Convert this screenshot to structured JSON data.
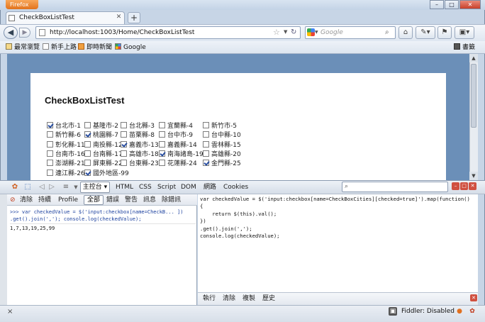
{
  "browser": {
    "app_button": "Firefox",
    "tab_title": "CheckBoxListTest",
    "new_tab": "+",
    "url": "http://localhost:1003/Home/CheckBoxListTest",
    "search_placeholder": "Google",
    "window_controls": {
      "min": "–",
      "max": "□",
      "close": "✕"
    }
  },
  "bookmarks": {
    "items": [
      {
        "label": "最常瀏覽",
        "icon": "bookmark-folder-icon"
      },
      {
        "label": "新手上路",
        "icon": "page-icon"
      },
      {
        "label": "即時新聞",
        "icon": "rss-icon"
      },
      {
        "label": "Google",
        "icon": "google-icon"
      }
    ],
    "right": "書籤"
  },
  "page": {
    "heading": "CheckBoxListTest",
    "checkbox_rows": [
      [
        {
          "label": "台北市-1",
          "checked": true
        },
        {
          "label": "基隆市-2",
          "checked": false
        },
        {
          "label": "台北縣-3",
          "checked": false
        },
        {
          "label": "宜蘭縣-4",
          "checked": false
        },
        {
          "label": "新竹市-5",
          "checked": false
        }
      ],
      [
        {
          "label": "新竹縣-6",
          "checked": false
        },
        {
          "label": "桃園縣-7",
          "checked": true
        },
        {
          "label": "苗栗縣-8",
          "checked": false
        },
        {
          "label": "台中市-9",
          "checked": false
        },
        {
          "label": "台中縣-10",
          "checked": false
        }
      ],
      [
        {
          "label": "彰化縣-11",
          "checked": false
        },
        {
          "label": "南投縣-12",
          "checked": false
        },
        {
          "label": "嘉義市-13",
          "checked": true
        },
        {
          "label": "嘉義縣-14",
          "checked": false
        },
        {
          "label": "雲林縣-15",
          "checked": false
        }
      ],
      [
        {
          "label": "台南市-16",
          "checked": false
        },
        {
          "label": "台南縣-17",
          "checked": false
        },
        {
          "label": "高雄市-18",
          "checked": false
        },
        {
          "label": "南海諸島-19",
          "checked": true
        },
        {
          "label": "高雄縣-20",
          "checked": false
        }
      ],
      [
        {
          "label": "澎湖縣-21",
          "checked": false
        },
        {
          "label": "屏東縣-22",
          "checked": false
        },
        {
          "label": "台東縣-23",
          "checked": false
        },
        {
          "label": "花蓮縣-24",
          "checked": false
        },
        {
          "label": "金門縣-25",
          "checked": true
        }
      ],
      [
        {
          "label": "連江縣-26",
          "checked": false
        },
        {
          "label": "國外地區-99",
          "checked": true
        }
      ]
    ]
  },
  "firebug": {
    "console_tab": "主控台",
    "tabs": [
      "HTML",
      "CSS",
      "Script",
      "DOM",
      "網路",
      "Cookies"
    ],
    "toolbar": {
      "clear": "清除",
      "persist": "持續",
      "profile": "Profile",
      "all": "全部",
      "errors": "錯誤",
      "warnings": "警告",
      "info": "訊息",
      "debug": "除錯訊"
    },
    "log_command_1": ">>> var checkedValue = $('input:checkbox[name=CheckB... ])",
    "log_command_2": ".get().join(','); console.log(checkedValue);",
    "log_output": "1,7,13,19,25,99",
    "editor_code": "var checkedValue = $('input:checkbox[name=CheckBoxCities][checked=true]').map(function()\n{\n    return $(this).val();\n})\n.get().join(',');\nconsole.log(checkedValue);",
    "editor_buttons": [
      "執行",
      "清除",
      "複製",
      "歷史"
    ]
  },
  "status": {
    "close": "×",
    "fiddler": "Fiddler: Disabled"
  }
}
